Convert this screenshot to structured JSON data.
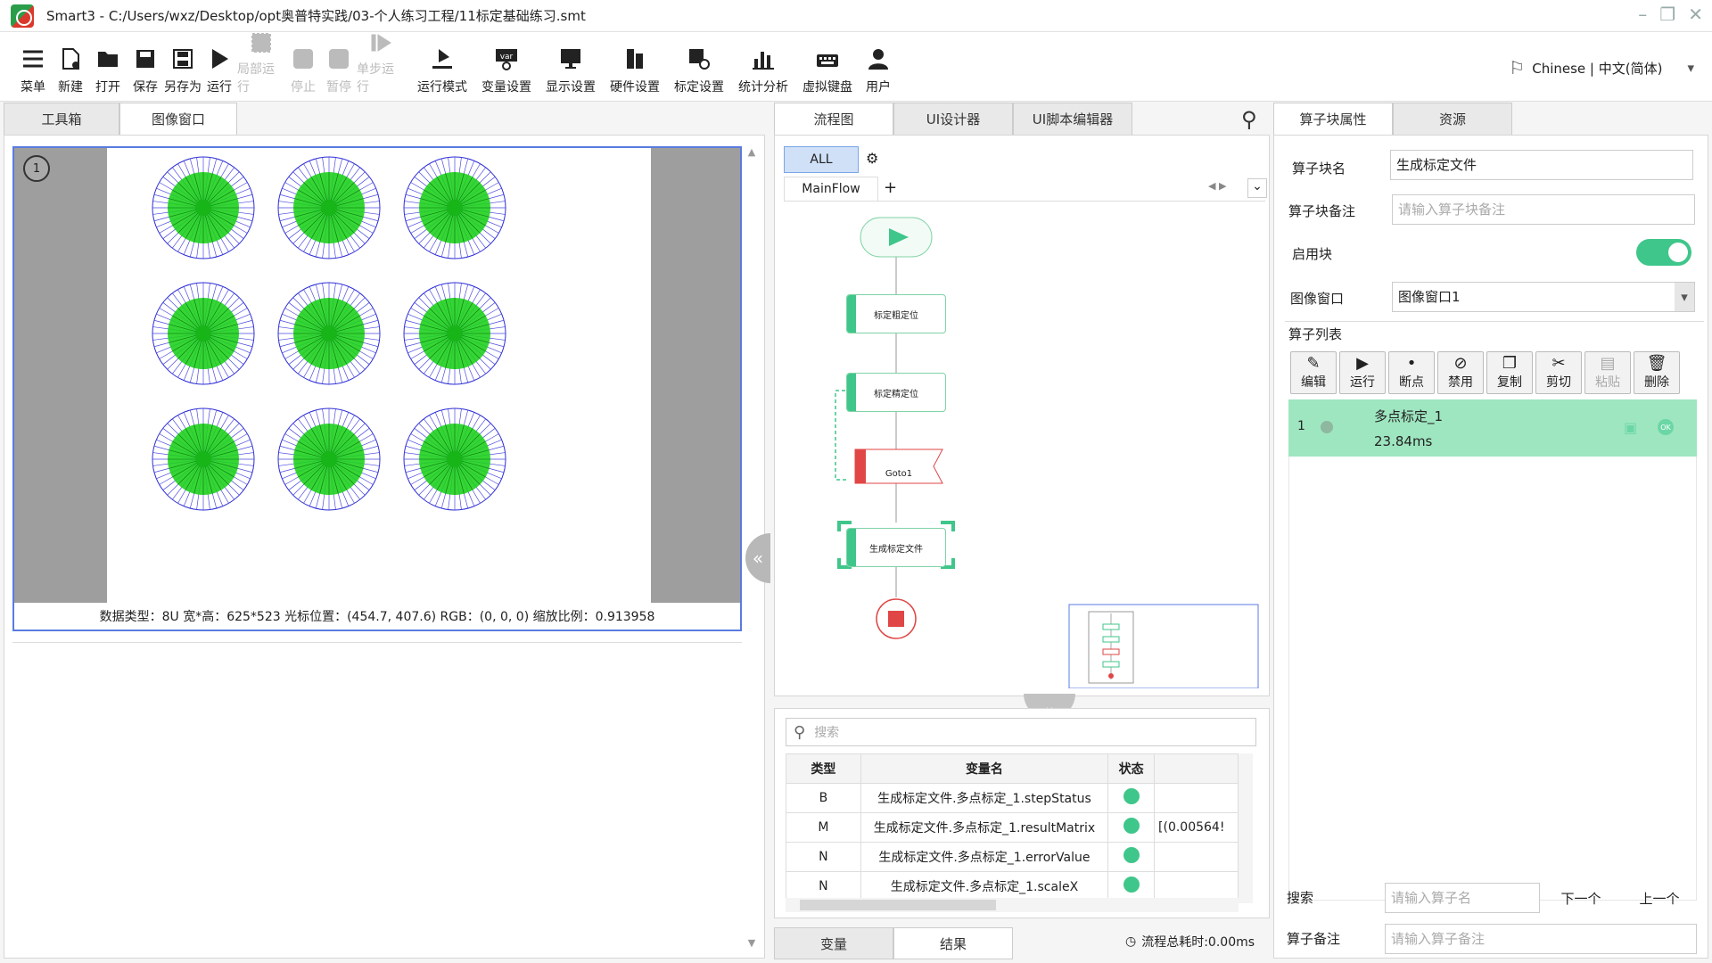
{
  "window": {
    "title": "Smart3 - C:/Users/wxz/Desktop/opt奥普特实践/03-个人练习工程/11标定基础练习.smt"
  },
  "toolbar": [
    {
      "label": "菜单",
      "icon": "menu-icon",
      "enabled": true
    },
    {
      "label": "新建",
      "icon": "new-file-icon",
      "enabled": true
    },
    {
      "label": "打开",
      "icon": "folder-open-icon",
      "enabled": true
    },
    {
      "label": "保存",
      "icon": "save-icon",
      "enabled": true
    },
    {
      "label": "另存为",
      "icon": "save-as-icon",
      "enabled": true
    },
    {
      "label": "运行",
      "icon": "play-icon",
      "enabled": true
    },
    {
      "label": "局部运行",
      "icon": "partial-run-icon",
      "enabled": false
    },
    {
      "label": "停止",
      "icon": "stop-icon",
      "enabled": false
    },
    {
      "label": "暂停",
      "icon": "pause-icon",
      "enabled": false
    },
    {
      "label": "单步运行",
      "icon": "step-run-icon",
      "enabled": false
    },
    {
      "label": "运行模式",
      "icon": "run-mode-icon",
      "enabled": true
    },
    {
      "label": "变量设置",
      "icon": "variable-icon",
      "enabled": true
    },
    {
      "label": "显示设置",
      "icon": "display-icon",
      "enabled": true
    },
    {
      "label": "硬件设置",
      "icon": "hardware-icon",
      "enabled": true
    },
    {
      "label": "标定设置",
      "icon": "calibration-icon",
      "enabled": true
    },
    {
      "label": "统计分析",
      "icon": "chart-icon",
      "enabled": true
    },
    {
      "label": "虚拟键盘",
      "icon": "keyboard-icon",
      "enabled": true
    },
    {
      "label": "用户",
      "icon": "user-icon",
      "enabled": true
    }
  ],
  "language": "Chinese | 中文(简体)",
  "left": {
    "tabs": [
      "工具箱",
      "图像窗口"
    ],
    "active_tab": "图像窗口",
    "window_index": "1",
    "status": "数据类型：8U 宽*高：625*523 光标位置：(454.7, 407.6) RGB：(0, 0, 0) 缩放比例：0.913958"
  },
  "middle": {
    "tabs": [
      "流程图",
      "UI设计器",
      "UI脚本编辑器"
    ],
    "active_tab": "流程图",
    "filter": "ALL",
    "flow_tab": "MainFlow",
    "nodes": [
      "标定粗定位",
      "标定精定位",
      "Goto1",
      "生成标定文件"
    ],
    "search_placeholder": "搜索",
    "columns": [
      "类型",
      "变量名",
      "状态"
    ],
    "rows": [
      {
        "type": "B",
        "name": "生成标定文件.多点标定_1.stepStatus",
        "value": ""
      },
      {
        "type": "M",
        "name": "生成标定文件.多点标定_1.resultMatrix",
        "value": "[(0.00564!"
      },
      {
        "type": "N",
        "name": "生成标定文件.多点标定_1.errorValue",
        "value": ""
      },
      {
        "type": "N",
        "name": "生成标定文件.多点标定_1.scaleX",
        "value": ""
      }
    ],
    "bottom_tabs": [
      "变量",
      "结果"
    ],
    "total_time": "流程总耗时:0.00ms"
  },
  "right": {
    "tabs": [
      "算子块属性",
      "资源"
    ],
    "block_name_label": "算子块名",
    "block_name": "生成标定文件",
    "block_note_label": "算子块备注",
    "block_note_placeholder": "请输入算子块备注",
    "enable_label": "启用块",
    "enabled": true,
    "image_window_label": "图像窗口",
    "image_window": "图像窗口1",
    "op_list_label": "算子列表",
    "op_buttons": [
      {
        "label": "编辑",
        "icon": "edit-icon",
        "enabled": true
      },
      {
        "label": "运行",
        "icon": "play-icon",
        "enabled": true
      },
      {
        "label": "断点",
        "icon": "breakpoint-icon",
        "enabled": true
      },
      {
        "label": "禁用",
        "icon": "disable-icon",
        "enabled": true
      },
      {
        "label": "复制",
        "icon": "copy-icon",
        "enabled": true
      },
      {
        "label": "剪切",
        "icon": "scissors-icon",
        "enabled": true
      },
      {
        "label": "粘贴",
        "icon": "paste-icon",
        "enabled": false
      },
      {
        "label": "删除",
        "icon": "trash-icon",
        "enabled": true
      }
    ],
    "ops": [
      {
        "index": "1",
        "name": "多点标定_1",
        "time": "23.84ms",
        "status": "OK"
      }
    ],
    "search_label": "搜索",
    "search_placeholder": "请输入算子名",
    "next": "下一个",
    "prev": "上一个",
    "op_note_label": "算子备注",
    "op_note_placeholder": "请输入算子备注"
  },
  "colors": {
    "accent": "#3fc68a",
    "selected_row": "#9ee6c0",
    "blue_border": "#5a7be0"
  }
}
